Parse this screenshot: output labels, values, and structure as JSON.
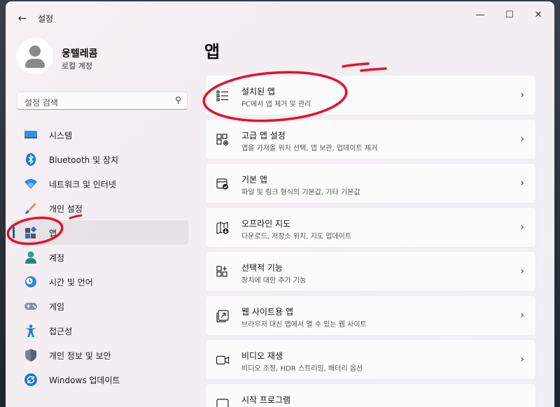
{
  "window": {
    "title": "설정",
    "back_glyph": "←",
    "min_glyph": "—",
    "max_glyph": "☐",
    "close_glyph": "✕"
  },
  "profile": {
    "name": "웅텔레콤",
    "account_type": "로컬 계정"
  },
  "search": {
    "placeholder": "설정 검색",
    "icon_glyph": "⚲"
  },
  "nav": {
    "items": [
      {
        "label": "시스템",
        "icon": "system-icon"
      },
      {
        "label": "Bluetooth 및 장치",
        "icon": "bluetooth-icon"
      },
      {
        "label": "네트워크 및 인터넷",
        "icon": "wifi-icon"
      },
      {
        "label": "개인 설정",
        "icon": "brush-icon"
      },
      {
        "label": "앱",
        "icon": "apps-icon",
        "selected": true
      },
      {
        "label": "계정",
        "icon": "account-icon"
      },
      {
        "label": "시간 및 언어",
        "icon": "clock-globe-icon"
      },
      {
        "label": "게임",
        "icon": "gamepad-icon"
      },
      {
        "label": "접근성",
        "icon": "accessibility-icon"
      },
      {
        "label": "개인 정보 및 보안",
        "icon": "shield-icon"
      },
      {
        "label": "Windows 업데이트",
        "icon": "update-icon"
      }
    ]
  },
  "main": {
    "title": "앱",
    "chevron_glyph": "›",
    "cards": [
      {
        "title": "설치된 앱",
        "desc": "PC에서 앱 제거 및 관리",
        "icon": "installed-apps-icon"
      },
      {
        "title": "고급 앱 설정",
        "desc": "앱을 가져올 위치 선택, 앱 보관, 업데이트 제거",
        "icon": "advanced-apps-icon"
      },
      {
        "title": "기본 앱",
        "desc": "파일 및 링크 형식의 기본값, 기타 기본값",
        "icon": "default-apps-icon"
      },
      {
        "title": "오프라인 지도",
        "desc": "다운로드, 저장소 위치, 지도 업데이트",
        "icon": "offline-maps-icon"
      },
      {
        "title": "선택적 기능",
        "desc": "장치에 대한 추가 기능",
        "icon": "optional-features-icon"
      },
      {
        "title": "웹 사이트용 앱",
        "desc": "브라우저 대신 앱에서 열 수 있는 웹 사이트",
        "icon": "web-apps-icon"
      },
      {
        "title": "비디오 재생",
        "desc": "비디오 조정, HDR 스트리밍, 배터리 옵션",
        "icon": "video-icon"
      },
      {
        "title": "시작 프로그램",
        "desc": "",
        "icon": "startup-icon"
      }
    ]
  },
  "colors": {
    "accent": "#005fb8",
    "annotation": "#e8102a"
  }
}
